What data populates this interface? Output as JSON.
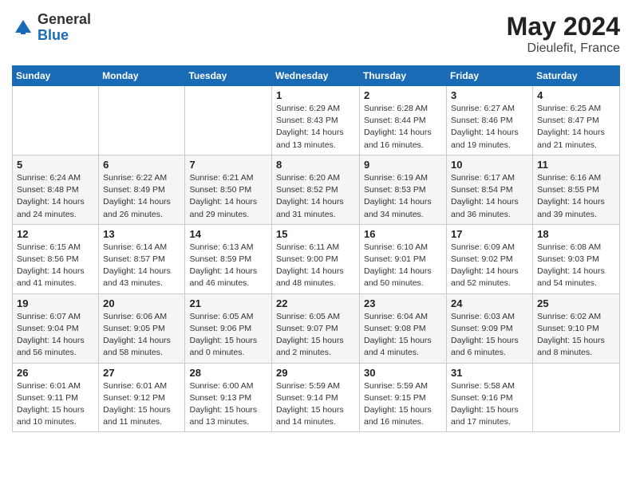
{
  "header": {
    "logo_general": "General",
    "logo_blue": "Blue",
    "month": "May 2024",
    "location": "Dieulefit, France"
  },
  "days_of_week": [
    "Sunday",
    "Monday",
    "Tuesday",
    "Wednesday",
    "Thursday",
    "Friday",
    "Saturday"
  ],
  "weeks": [
    [
      {
        "day": "",
        "info": ""
      },
      {
        "day": "",
        "info": ""
      },
      {
        "day": "",
        "info": ""
      },
      {
        "day": "1",
        "info": "Sunrise: 6:29 AM\nSunset: 8:43 PM\nDaylight: 14 hours\nand 13 minutes."
      },
      {
        "day": "2",
        "info": "Sunrise: 6:28 AM\nSunset: 8:44 PM\nDaylight: 14 hours\nand 16 minutes."
      },
      {
        "day": "3",
        "info": "Sunrise: 6:27 AM\nSunset: 8:46 PM\nDaylight: 14 hours\nand 19 minutes."
      },
      {
        "day": "4",
        "info": "Sunrise: 6:25 AM\nSunset: 8:47 PM\nDaylight: 14 hours\nand 21 minutes."
      }
    ],
    [
      {
        "day": "5",
        "info": "Sunrise: 6:24 AM\nSunset: 8:48 PM\nDaylight: 14 hours\nand 24 minutes."
      },
      {
        "day": "6",
        "info": "Sunrise: 6:22 AM\nSunset: 8:49 PM\nDaylight: 14 hours\nand 26 minutes."
      },
      {
        "day": "7",
        "info": "Sunrise: 6:21 AM\nSunset: 8:50 PM\nDaylight: 14 hours\nand 29 minutes."
      },
      {
        "day": "8",
        "info": "Sunrise: 6:20 AM\nSunset: 8:52 PM\nDaylight: 14 hours\nand 31 minutes."
      },
      {
        "day": "9",
        "info": "Sunrise: 6:19 AM\nSunset: 8:53 PM\nDaylight: 14 hours\nand 34 minutes."
      },
      {
        "day": "10",
        "info": "Sunrise: 6:17 AM\nSunset: 8:54 PM\nDaylight: 14 hours\nand 36 minutes."
      },
      {
        "day": "11",
        "info": "Sunrise: 6:16 AM\nSunset: 8:55 PM\nDaylight: 14 hours\nand 39 minutes."
      }
    ],
    [
      {
        "day": "12",
        "info": "Sunrise: 6:15 AM\nSunset: 8:56 PM\nDaylight: 14 hours\nand 41 minutes."
      },
      {
        "day": "13",
        "info": "Sunrise: 6:14 AM\nSunset: 8:57 PM\nDaylight: 14 hours\nand 43 minutes."
      },
      {
        "day": "14",
        "info": "Sunrise: 6:13 AM\nSunset: 8:59 PM\nDaylight: 14 hours\nand 46 minutes."
      },
      {
        "day": "15",
        "info": "Sunrise: 6:11 AM\nSunset: 9:00 PM\nDaylight: 14 hours\nand 48 minutes."
      },
      {
        "day": "16",
        "info": "Sunrise: 6:10 AM\nSunset: 9:01 PM\nDaylight: 14 hours\nand 50 minutes."
      },
      {
        "day": "17",
        "info": "Sunrise: 6:09 AM\nSunset: 9:02 PM\nDaylight: 14 hours\nand 52 minutes."
      },
      {
        "day": "18",
        "info": "Sunrise: 6:08 AM\nSunset: 9:03 PM\nDaylight: 14 hours\nand 54 minutes."
      }
    ],
    [
      {
        "day": "19",
        "info": "Sunrise: 6:07 AM\nSunset: 9:04 PM\nDaylight: 14 hours\nand 56 minutes."
      },
      {
        "day": "20",
        "info": "Sunrise: 6:06 AM\nSunset: 9:05 PM\nDaylight: 14 hours\nand 58 minutes."
      },
      {
        "day": "21",
        "info": "Sunrise: 6:05 AM\nSunset: 9:06 PM\nDaylight: 15 hours\nand 0 minutes."
      },
      {
        "day": "22",
        "info": "Sunrise: 6:05 AM\nSunset: 9:07 PM\nDaylight: 15 hours\nand 2 minutes."
      },
      {
        "day": "23",
        "info": "Sunrise: 6:04 AM\nSunset: 9:08 PM\nDaylight: 15 hours\nand 4 minutes."
      },
      {
        "day": "24",
        "info": "Sunrise: 6:03 AM\nSunset: 9:09 PM\nDaylight: 15 hours\nand 6 minutes."
      },
      {
        "day": "25",
        "info": "Sunrise: 6:02 AM\nSunset: 9:10 PM\nDaylight: 15 hours\nand 8 minutes."
      }
    ],
    [
      {
        "day": "26",
        "info": "Sunrise: 6:01 AM\nSunset: 9:11 PM\nDaylight: 15 hours\nand 10 minutes."
      },
      {
        "day": "27",
        "info": "Sunrise: 6:01 AM\nSunset: 9:12 PM\nDaylight: 15 hours\nand 11 minutes."
      },
      {
        "day": "28",
        "info": "Sunrise: 6:00 AM\nSunset: 9:13 PM\nDaylight: 15 hours\nand 13 minutes."
      },
      {
        "day": "29",
        "info": "Sunrise: 5:59 AM\nSunset: 9:14 PM\nDaylight: 15 hours\nand 14 minutes."
      },
      {
        "day": "30",
        "info": "Sunrise: 5:59 AM\nSunset: 9:15 PM\nDaylight: 15 hours\nand 16 minutes."
      },
      {
        "day": "31",
        "info": "Sunrise: 5:58 AM\nSunset: 9:16 PM\nDaylight: 15 hours\nand 17 minutes."
      },
      {
        "day": "",
        "info": ""
      }
    ]
  ]
}
